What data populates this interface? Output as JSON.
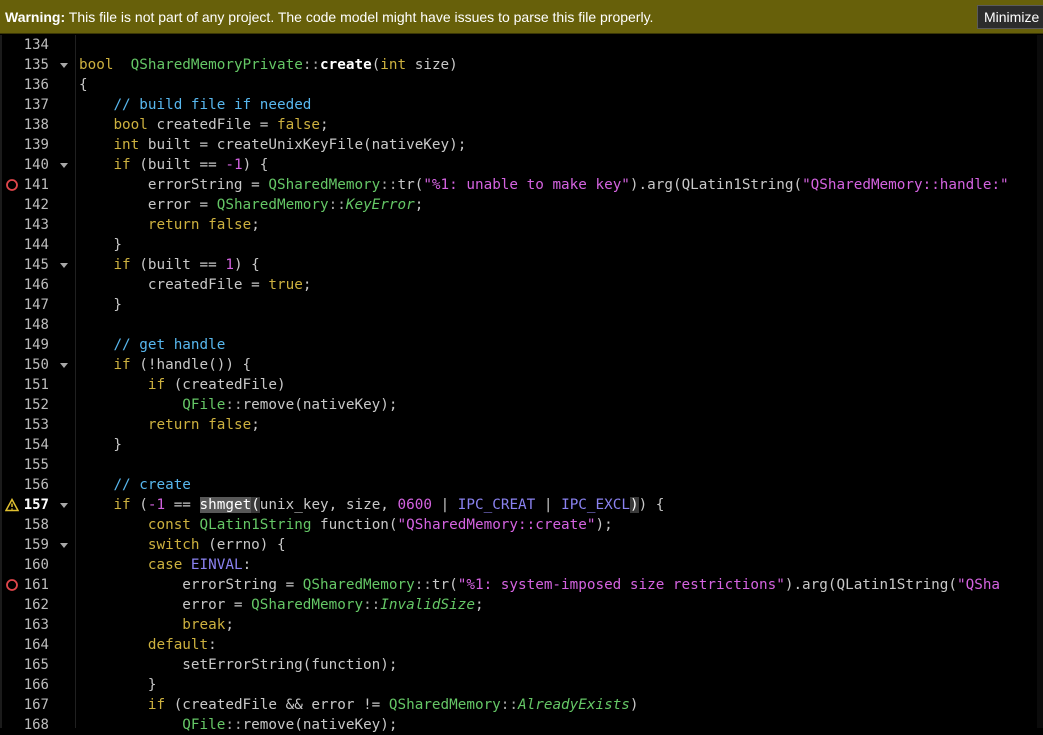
{
  "warning": {
    "label": "Warning:",
    "message": " This file is not part of any project. The code model might have issues to parse this file properly.",
    "button": "Minimize"
  },
  "colors": {
    "warning_bg": "#67600a",
    "keyword": "#cdb13f",
    "type": "#65c766",
    "comment": "#58b7ee",
    "string": "#d463e0",
    "macro": "#8a82f0",
    "breakpoint": "#e0464b",
    "warning_marker": "#e0c030"
  },
  "lines": [
    {
      "n": "134",
      "fold": false,
      "mark": "",
      "tokens": []
    },
    {
      "n": "135",
      "fold": true,
      "mark": "",
      "tokens": [
        [
          "kw",
          "bool"
        ],
        [
          "",
          "  "
        ],
        [
          "ty",
          "QSharedMemoryPrivate"
        ],
        [
          "op",
          "::"
        ],
        [
          "bfn",
          "create"
        ],
        [
          "",
          "("
        ],
        [
          "kw",
          "int"
        ],
        [
          "",
          " size)"
        ]
      ]
    },
    {
      "n": "136",
      "fold": false,
      "mark": "",
      "tokens": [
        [
          "",
          "{"
        ]
      ]
    },
    {
      "n": "137",
      "fold": false,
      "mark": "",
      "tokens": [
        [
          "",
          "    "
        ],
        [
          "cm",
          "// build file if needed"
        ]
      ]
    },
    {
      "n": "138",
      "fold": false,
      "mark": "",
      "tokens": [
        [
          "",
          "    "
        ],
        [
          "kw",
          "bool"
        ],
        [
          "",
          " createdFile = "
        ],
        [
          "kw",
          "false"
        ],
        [
          "",
          ";"
        ]
      ]
    },
    {
      "n": "139",
      "fold": false,
      "mark": "",
      "tokens": [
        [
          "",
          "    "
        ],
        [
          "kw",
          "int"
        ],
        [
          "",
          " built = createUnixKeyFile(nativeKey);"
        ]
      ]
    },
    {
      "n": "140",
      "fold": true,
      "mark": "",
      "tokens": [
        [
          "",
          "    "
        ],
        [
          "kw",
          "if"
        ],
        [
          "",
          " (built == "
        ],
        [
          "nm",
          "-1"
        ],
        [
          "",
          ") {"
        ]
      ]
    },
    {
      "n": "141",
      "fold": false,
      "mark": "bp",
      "tokens": [
        [
          "",
          "        errorString = "
        ],
        [
          "ty",
          "QSharedMemory"
        ],
        [
          "op",
          "::"
        ],
        [
          "",
          "tr("
        ],
        [
          "st",
          "\"%1: unable to make key\""
        ],
        [
          "",
          ").arg(QLatin1String("
        ],
        [
          "st",
          "\"QSharedMemory::handle:\""
        ]
      ]
    },
    {
      "n": "142",
      "fold": false,
      "mark": "",
      "tokens": [
        [
          "",
          "        error = "
        ],
        [
          "ty",
          "QSharedMemory"
        ],
        [
          "op",
          "::"
        ],
        [
          "it",
          "KeyError"
        ],
        [
          "",
          ";"
        ]
      ]
    },
    {
      "n": "143",
      "fold": false,
      "mark": "",
      "tokens": [
        [
          "",
          "        "
        ],
        [
          "kw",
          "return"
        ],
        [
          "",
          " "
        ],
        [
          "kw",
          "false"
        ],
        [
          "",
          ";"
        ]
      ]
    },
    {
      "n": "144",
      "fold": false,
      "mark": "",
      "tokens": [
        [
          "",
          "    }"
        ]
      ]
    },
    {
      "n": "145",
      "fold": true,
      "mark": "",
      "tokens": [
        [
          "",
          "    "
        ],
        [
          "kw",
          "if"
        ],
        [
          "",
          " (built == "
        ],
        [
          "nm",
          "1"
        ],
        [
          "",
          ") {"
        ]
      ]
    },
    {
      "n": "146",
      "fold": false,
      "mark": "",
      "tokens": [
        [
          "",
          "        createdFile = "
        ],
        [
          "kw",
          "true"
        ],
        [
          "",
          ";"
        ]
      ]
    },
    {
      "n": "147",
      "fold": false,
      "mark": "",
      "tokens": [
        [
          "",
          "    }"
        ]
      ]
    },
    {
      "n": "148",
      "fold": false,
      "mark": "",
      "tokens": []
    },
    {
      "n": "149",
      "fold": false,
      "mark": "",
      "tokens": [
        [
          "",
          "    "
        ],
        [
          "cm",
          "// get handle"
        ]
      ]
    },
    {
      "n": "150",
      "fold": true,
      "mark": "",
      "tokens": [
        [
          "",
          "    "
        ],
        [
          "kw",
          "if"
        ],
        [
          "",
          " (!handle()) {"
        ]
      ]
    },
    {
      "n": "151",
      "fold": false,
      "mark": "",
      "tokens": [
        [
          "",
          "        "
        ],
        [
          "kw",
          "if"
        ],
        [
          "",
          " (createdFile)"
        ]
      ]
    },
    {
      "n": "152",
      "fold": false,
      "mark": "",
      "tokens": [
        [
          "",
          "            "
        ],
        [
          "ty",
          "QFile"
        ],
        [
          "op",
          "::"
        ],
        [
          "",
          "remove(nativeKey);"
        ]
      ]
    },
    {
      "n": "153",
      "fold": false,
      "mark": "",
      "tokens": [
        [
          "",
          "        "
        ],
        [
          "kw",
          "return"
        ],
        [
          "",
          " "
        ],
        [
          "kw",
          "false"
        ],
        [
          "",
          ";"
        ]
      ]
    },
    {
      "n": "154",
      "fold": false,
      "mark": "",
      "tokens": [
        [
          "",
          "    }"
        ]
      ]
    },
    {
      "n": "155",
      "fold": false,
      "mark": "",
      "tokens": []
    },
    {
      "n": "156",
      "fold": false,
      "mark": "",
      "tokens": [
        [
          "",
          "    "
        ],
        [
          "cm",
          "// create"
        ]
      ]
    },
    {
      "n": "157",
      "fold": true,
      "mark": "warn",
      "cur": true,
      "tokens": [
        [
          "",
          "    "
        ],
        [
          "kw",
          "if"
        ],
        [
          "",
          " ("
        ],
        [
          "nm",
          "-1"
        ],
        [
          "",
          " == "
        ],
        [
          "hl",
          "shmget"
        ],
        [
          "br",
          "("
        ],
        [
          "",
          "unix_key, size, "
        ],
        [
          "nm",
          "0600"
        ],
        [
          "",
          " | "
        ],
        [
          "mc",
          "IPC_CREAT"
        ],
        [
          "",
          " | "
        ],
        [
          "mc",
          "IPC_EXCL"
        ],
        [
          "br",
          ")"
        ],
        [
          "",
          ") {"
        ]
      ]
    },
    {
      "n": "158",
      "fold": false,
      "mark": "",
      "tokens": [
        [
          "",
          "        "
        ],
        [
          "kw",
          "const"
        ],
        [
          "",
          " "
        ],
        [
          "ty",
          "QLatin1String"
        ],
        [
          "",
          " function("
        ],
        [
          "st",
          "\"QSharedMemory::create\""
        ],
        [
          "",
          ");"
        ]
      ]
    },
    {
      "n": "159",
      "fold": true,
      "mark": "",
      "tokens": [
        [
          "",
          "        "
        ],
        [
          "kw",
          "switch"
        ],
        [
          "",
          " (errno) {"
        ]
      ]
    },
    {
      "n": "160",
      "fold": false,
      "mark": "",
      "tokens": [
        [
          "",
          "        "
        ],
        [
          "kw",
          "case"
        ],
        [
          "",
          " "
        ],
        [
          "mc",
          "EINVAL"
        ],
        [
          "",
          ":"
        ]
      ]
    },
    {
      "n": "161",
      "fold": false,
      "mark": "bp",
      "tokens": [
        [
          "",
          "            errorString = "
        ],
        [
          "ty",
          "QSharedMemory"
        ],
        [
          "op",
          "::"
        ],
        [
          "",
          "tr("
        ],
        [
          "st",
          "\"%1: system-imposed size restrictions\""
        ],
        [
          "",
          ").arg(QLatin1String("
        ],
        [
          "st",
          "\"QSha"
        ]
      ]
    },
    {
      "n": "162",
      "fold": false,
      "mark": "",
      "tokens": [
        [
          "",
          "            error = "
        ],
        [
          "ty",
          "QSharedMemory"
        ],
        [
          "op",
          "::"
        ],
        [
          "it",
          "InvalidSize"
        ],
        [
          "",
          ";"
        ]
      ]
    },
    {
      "n": "163",
      "fold": false,
      "mark": "",
      "tokens": [
        [
          "",
          "            "
        ],
        [
          "kw",
          "break"
        ],
        [
          "",
          ";"
        ]
      ]
    },
    {
      "n": "164",
      "fold": false,
      "mark": "",
      "tokens": [
        [
          "",
          "        "
        ],
        [
          "kw",
          "default"
        ],
        [
          "",
          ":"
        ]
      ]
    },
    {
      "n": "165",
      "fold": false,
      "mark": "",
      "tokens": [
        [
          "",
          "            setErrorString(function);"
        ]
      ]
    },
    {
      "n": "166",
      "fold": false,
      "mark": "",
      "tokens": [
        [
          "",
          "        }"
        ]
      ]
    },
    {
      "n": "167",
      "fold": false,
      "mark": "",
      "tokens": [
        [
          "",
          "        "
        ],
        [
          "kw",
          "if"
        ],
        [
          "",
          " (createdFile && error != "
        ],
        [
          "ty",
          "QSharedMemory"
        ],
        [
          "op",
          "::"
        ],
        [
          "it",
          "AlreadyExists"
        ],
        [
          "",
          ")"
        ]
      ]
    },
    {
      "n": "168",
      "fold": false,
      "mark": "",
      "tokens": [
        [
          "",
          "            "
        ],
        [
          "ty",
          "QFile"
        ],
        [
          "op",
          "::"
        ],
        [
          "",
          "remove(nativeKey);"
        ]
      ]
    }
  ]
}
